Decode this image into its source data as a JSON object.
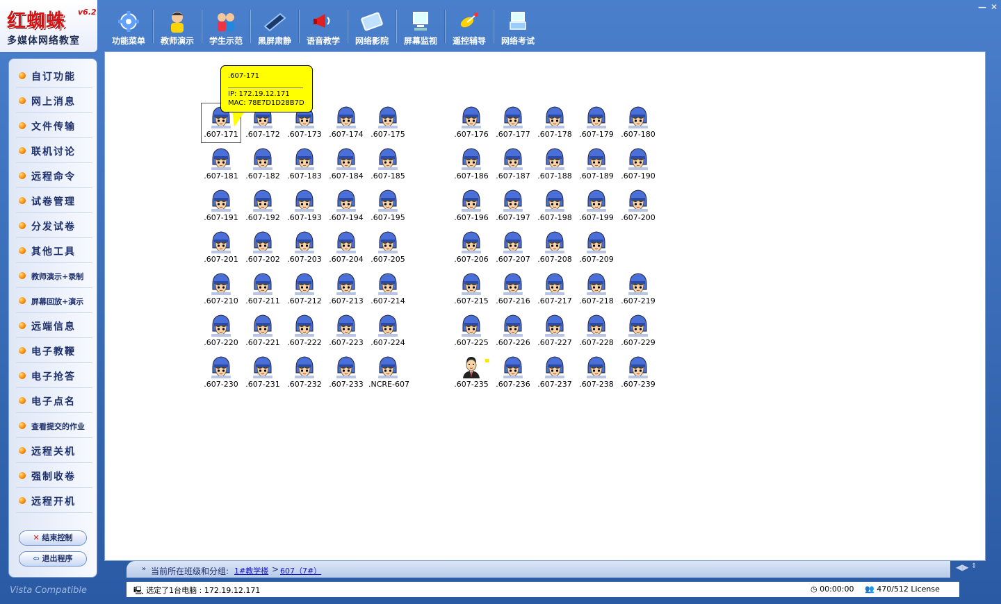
{
  "app": {
    "title": "红蜘蛛",
    "version": "v6.2",
    "subtitle": "多媒体网络教室",
    "vista": "Vista Compatible"
  },
  "toolbar": [
    {
      "label": "功能菜单",
      "icon": "gear-icon"
    },
    {
      "label": "教师演示",
      "icon": "teacher-icon"
    },
    {
      "label": "学生示范",
      "icon": "students-icon"
    },
    {
      "label": "黑屏肃静",
      "icon": "black-screen-icon"
    },
    {
      "label": "语音教学",
      "icon": "megaphone-icon"
    },
    {
      "label": "网络影院",
      "icon": "film-icon"
    },
    {
      "label": "屏幕监视",
      "icon": "monitor-icon"
    },
    {
      "label": "遥控辅导",
      "icon": "satellite-icon"
    },
    {
      "label": "网络考试",
      "icon": "exam-icon"
    }
  ],
  "window_controls": {
    "minimize": "—",
    "close": "✕"
  },
  "sidebar": {
    "items": [
      {
        "label": "自订功能"
      },
      {
        "label": "网上消息"
      },
      {
        "label": "文件传输"
      },
      {
        "label": "联机讨论"
      },
      {
        "label": "远程命令"
      },
      {
        "label": "试卷管理"
      },
      {
        "label": "分发试卷"
      },
      {
        "label": "其他工具"
      },
      {
        "label": "教师演示+录制",
        "small": true
      },
      {
        "label": "屏幕回放+演示",
        "small": true
      },
      {
        "label": "远端信息"
      },
      {
        "label": "电子教鞭"
      },
      {
        "label": "电子抢答"
      },
      {
        "label": "电子点名"
      },
      {
        "label": "查看提交的作业",
        "small": true
      },
      {
        "label": "远程关机"
      },
      {
        "label": "强制收卷"
      },
      {
        "label": "远程开机"
      }
    ],
    "end_control": "结束控制",
    "exit": "退出程序"
  },
  "tooltip": {
    "name": ".607-171",
    "ip": "IP: 172.19.12.171",
    "mac": "MAC: 78E7D1D28B7D"
  },
  "computers": [
    [
      ".607-171",
      ".607-172",
      ".607-173",
      ".607-174",
      ".607-175",
      "",
      ".607-176",
      ".607-177",
      ".607-178",
      ".607-179",
      ".607-180"
    ],
    [
      ".607-181",
      ".607-182",
      ".607-183",
      ".607-184",
      ".607-185",
      "",
      ".607-186",
      ".607-187",
      ".607-188",
      ".607-189",
      ".607-190"
    ],
    [
      ".607-191",
      ".607-192",
      ".607-193",
      ".607-194",
      ".607-195",
      "",
      ".607-196",
      ".607-197",
      ".607-198",
      ".607-199",
      ".607-200"
    ],
    [
      ".607-201",
      ".607-202",
      ".607-203",
      ".607-204",
      ".607-205",
      "",
      ".607-206",
      ".607-207",
      ".607-208",
      ".607-209",
      ""
    ],
    [
      ".607-210",
      ".607-211",
      ".607-212",
      ".607-213",
      ".607-214",
      "",
      ".607-215",
      ".607-216",
      ".607-217",
      ".607-218",
      ".607-219"
    ],
    [
      ".607-220",
      ".607-221",
      ".607-222",
      ".607-223",
      ".607-224",
      "",
      ".607-225",
      ".607-226",
      ".607-227",
      ".607-228",
      ".607-229"
    ],
    [
      ".607-230",
      ".607-231",
      ".607-232",
      ".607-233",
      ".NCRE-607",
      "",
      ".607-235",
      ".607-236",
      ".607-237",
      ".607-238",
      ".607-239"
    ]
  ],
  "selected_computer": ".607-171",
  "teacher_computer": ".607-235",
  "breadcrumb": {
    "prefix": "当前所在班级和分组:",
    "building": "1#教学楼",
    "sep": ">",
    "room": "607（7#）"
  },
  "status": {
    "selection": "选定了1台电脑 : 172.19.12.171",
    "time": "00:00:00",
    "license": "470/512 License"
  },
  "colors": {
    "frame": "#2f5fa8",
    "logo_red": "#d41414",
    "tooltip": "#ffff00",
    "avatar_cap": "#4a6fd8"
  }
}
